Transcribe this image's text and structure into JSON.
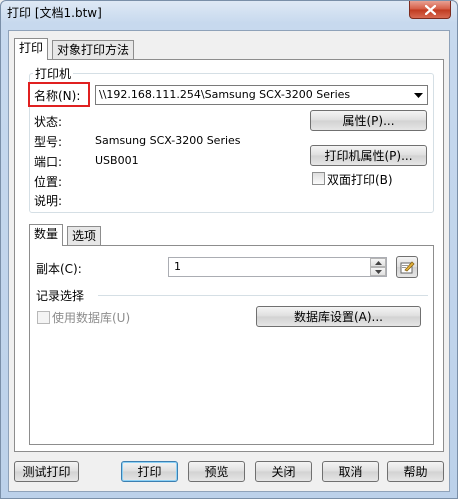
{
  "window": {
    "title": "打印 [文档1.btw]"
  },
  "tabs": {
    "print": "打印",
    "object_print": "对象打印方法"
  },
  "printer": {
    "group_title": "打印机",
    "name_label": "名称(N):",
    "name_value": "\\\\192.168.111.254\\Samsung SCX-3200 Series",
    "status_label": "状态:",
    "model_label": "型号:",
    "model_value": "Samsung SCX-3200 Series",
    "port_label": "端口:",
    "port_value": "USB001",
    "location_label": "位置:",
    "comment_label": "说明:",
    "properties_button": "属性(P)...",
    "printer_properties_button": "打印机属性(P)...",
    "duplex_label": "双面打印(B)"
  },
  "subtabs": {
    "quantity": "数量",
    "options": "选项"
  },
  "quantity": {
    "copies_label": "副本(C):",
    "copies_value": "1",
    "record_group_title": "记录选择",
    "use_database_label": "使用数据库(U)",
    "database_settings_button": "数据库设置(A)..."
  },
  "footer": {
    "test_print": "测试打印",
    "print": "打印",
    "preview": "预览",
    "close": "关闭",
    "cancel": "取消",
    "help": "帮助"
  },
  "icons": {
    "close": "close-icon",
    "dropdown": "chevron-down-icon",
    "spin_up": "spin-up-icon",
    "spin_down": "spin-down-icon",
    "copies_tool": "edit-icon"
  },
  "colors": {
    "highlight": "#e02020",
    "default_button_border": "#3c7fb1"
  }
}
